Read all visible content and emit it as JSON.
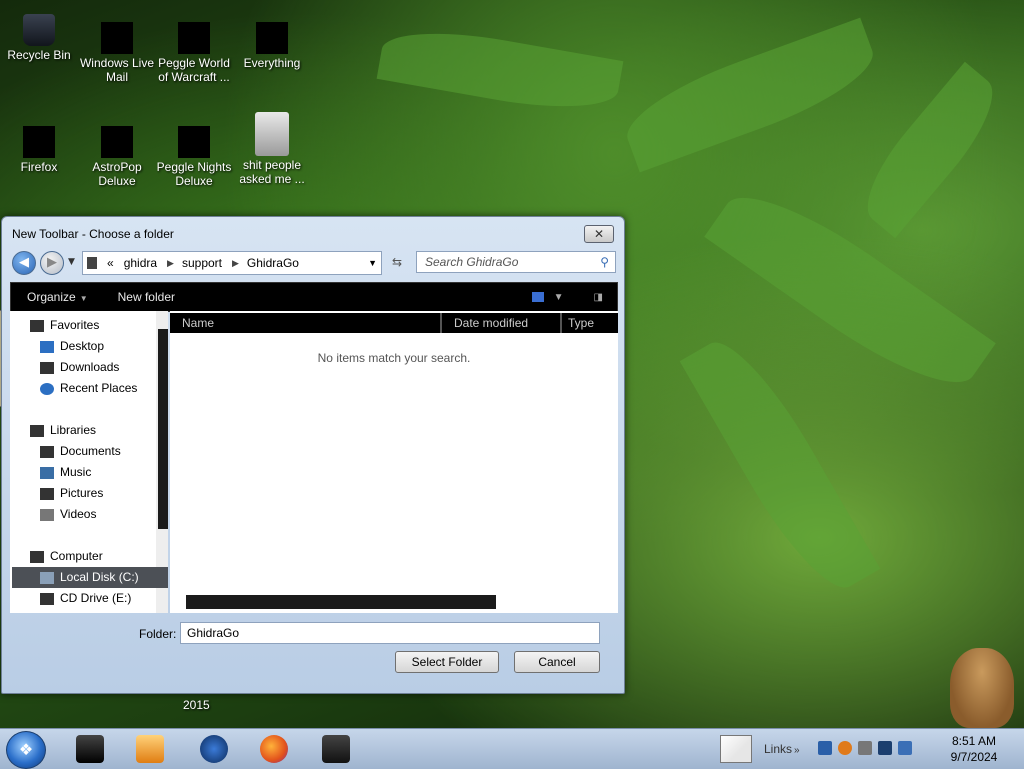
{
  "desktop": {
    "icons": [
      {
        "label": "Recycle Bin",
        "icon": "recycle-bin-icon"
      },
      {
        "label": "Windows Live Mail",
        "icon": "windows-live-mail-icon"
      },
      {
        "label": "Peggle World of Warcraft ...",
        "icon": "peggle-wow-icon"
      },
      {
        "label": "Everything",
        "icon": "everything-icon"
      },
      {
        "label": "Firefox",
        "icon": "firefox-icon"
      },
      {
        "label": "AstroPop Deluxe",
        "icon": "astropop-icon"
      },
      {
        "label": "Peggle Nights Deluxe",
        "icon": "peggle-nights-icon"
      },
      {
        "label": "shit people asked me ...",
        "icon": "folder-icon"
      }
    ],
    "year_text": "2015"
  },
  "dialog": {
    "title": "New Toolbar - Choose a folder",
    "close_glyph": "✕",
    "breadcrumb": {
      "prefix": "«",
      "items": [
        "ghidra",
        "support",
        "GhidraGo"
      ]
    },
    "search_placeholder": "Search GhidraGo",
    "toolbar": {
      "organize": "Organize",
      "new_folder": "New folder"
    },
    "nav": {
      "favorites": "Favorites",
      "desktop": "Desktop",
      "downloads": "Downloads",
      "recent_places": "Recent Places",
      "libraries": "Libraries",
      "documents": "Documents",
      "music": "Music",
      "pictures": "Pictures",
      "videos": "Videos",
      "computer": "Computer",
      "local_disk": "Local Disk (C:)",
      "cd_drive": "CD Drive (E:)"
    },
    "columns": {
      "name": "Name",
      "date_modified": "Date modified",
      "type": "Type"
    },
    "empty_message": "No items match your search.",
    "folder_label": "Folder:",
    "folder_value": "GhidraGo",
    "select_button": "Select Folder",
    "cancel_button": "Cancel"
  },
  "taskbar": {
    "links_label": "Links",
    "time": "8:51 AM",
    "date": "9/7/2024"
  },
  "colors": {
    "selection": "#4c5056",
    "toolbar_bg": "#000000",
    "taskbar": "#b4c6de"
  }
}
